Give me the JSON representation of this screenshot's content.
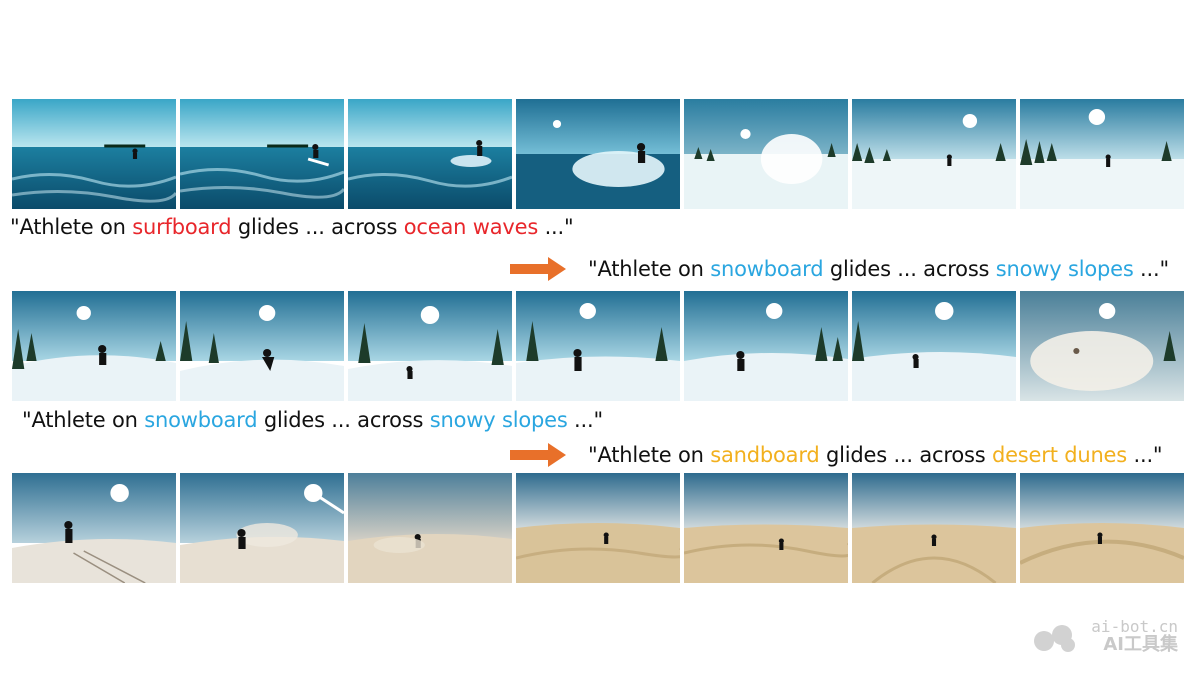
{
  "rows": [
    {
      "scene": "ocean-to-snow",
      "frames": [
        "ocean",
        "ocean",
        "ocean",
        "ocean-spray",
        "snow-spray",
        "snow",
        "snow"
      ]
    },
    {
      "scene": "snow",
      "frames": [
        "snow",
        "snow",
        "snow",
        "snow",
        "snow",
        "snow",
        "snow-haze"
      ]
    },
    {
      "scene": "snow-to-desert",
      "frames": [
        "desert-sun",
        "desert-sun",
        "desert",
        "desert",
        "desert",
        "desert",
        "desert"
      ]
    }
  ],
  "captions": {
    "c1": {
      "q1": "\"Athlete on ",
      "w1": "surfboard",
      "m": " glides ... across ",
      "w2": "ocean waves",
      "q2": " ...\""
    },
    "c2": {
      "q1": "\"Athlete on ",
      "w1": "snowboard",
      "m": " glides ... across ",
      "w2": "snowy slopes",
      "q2": " ...\""
    },
    "c3": {
      "q1": "\"Athlete on ",
      "w1": "snowboard",
      "m": " glides ... across ",
      "w2": "snowy slopes",
      "q2": " ...\""
    },
    "c4": {
      "q1": "\"Athlete on ",
      "w1": "sandboard",
      "m": " glides ... across ",
      "w2": "desert dunes",
      "q2": " ...\""
    }
  },
  "colors": {
    "red": "#e8262b",
    "blue": "#2aa6e0",
    "yellow": "#f2b01e",
    "arrow": "#e8702a"
  },
  "watermark": {
    "top": "ai-bot.cn",
    "bottom": "AI工具集"
  }
}
